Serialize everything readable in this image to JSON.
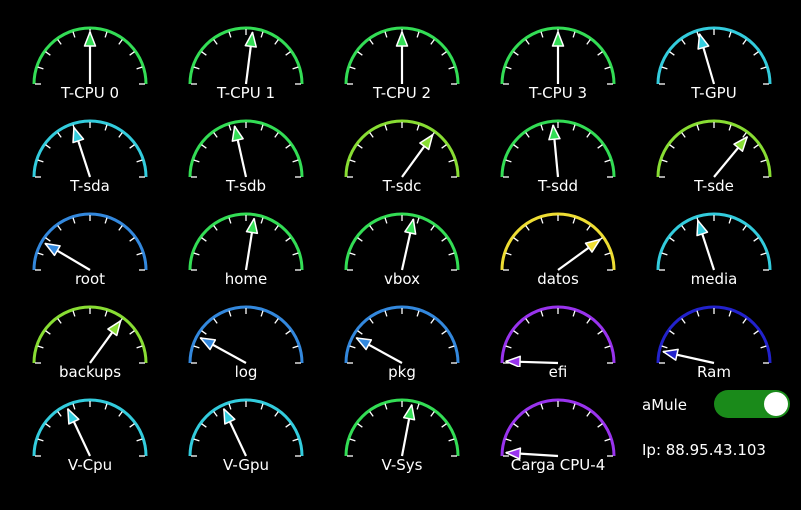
{
  "gauges": [
    {
      "label": "T-CPU 0",
      "color": "#33dd55",
      "value": 0.5
    },
    {
      "label": "T-CPU 1",
      "color": "#33dd55",
      "value": 0.54
    },
    {
      "label": "T-CPU 2",
      "color": "#33dd55",
      "value": 0.5
    },
    {
      "label": "T-CPU 3",
      "color": "#33dd55",
      "value": 0.5
    },
    {
      "label": "T-GPU",
      "color": "#33ccdd",
      "value": 0.41
    },
    {
      "label": "T-sda",
      "color": "#33ccdd",
      "value": 0.4
    },
    {
      "label": "T-sdb",
      "color": "#33dd55",
      "value": 0.43
    },
    {
      "label": "T-sdc",
      "color": "#88dd33",
      "value": 0.7
    },
    {
      "label": "T-sdd",
      "color": "#33dd55",
      "value": 0.47
    },
    {
      "label": "T-sde",
      "color": "#88dd33",
      "value": 0.72
    },
    {
      "label": "root",
      "color": "#3388dd",
      "value": 0.17
    },
    {
      "label": "home",
      "color": "#33dd55",
      "value": 0.55
    },
    {
      "label": "vbox",
      "color": "#33dd55",
      "value": 0.57
    },
    {
      "label": "datos",
      "color": "#eedd33",
      "value": 0.8
    },
    {
      "label": "media",
      "color": "#33ccdd",
      "value": 0.4
    },
    {
      "label": "backups",
      "color": "#88dd33",
      "value": 0.7
    },
    {
      "label": "log",
      "color": "#3388dd",
      "value": 0.16
    },
    {
      "label": "pkg",
      "color": "#3388dd",
      "value": 0.16
    },
    {
      "label": "efi",
      "color": "#9933ee",
      "value": 0.01
    },
    {
      "label": "Ram",
      "color": "#2222cc",
      "value": 0.07
    },
    {
      "label": "V-Cpu",
      "color": "#33ccdd",
      "value": 0.36
    },
    {
      "label": "V-Gpu",
      "color": "#33ccdd",
      "value": 0.36
    },
    {
      "label": "V-Sys",
      "color": "#33dd55",
      "value": 0.56
    },
    {
      "label": "Carga CPU-4",
      "color": "#9933ee",
      "value": 0.02
    }
  ],
  "amule": {
    "label": "aMule",
    "on": true,
    "color": "#1a8a1a"
  },
  "ip": {
    "text": "Ip: 88.95.43.103"
  }
}
